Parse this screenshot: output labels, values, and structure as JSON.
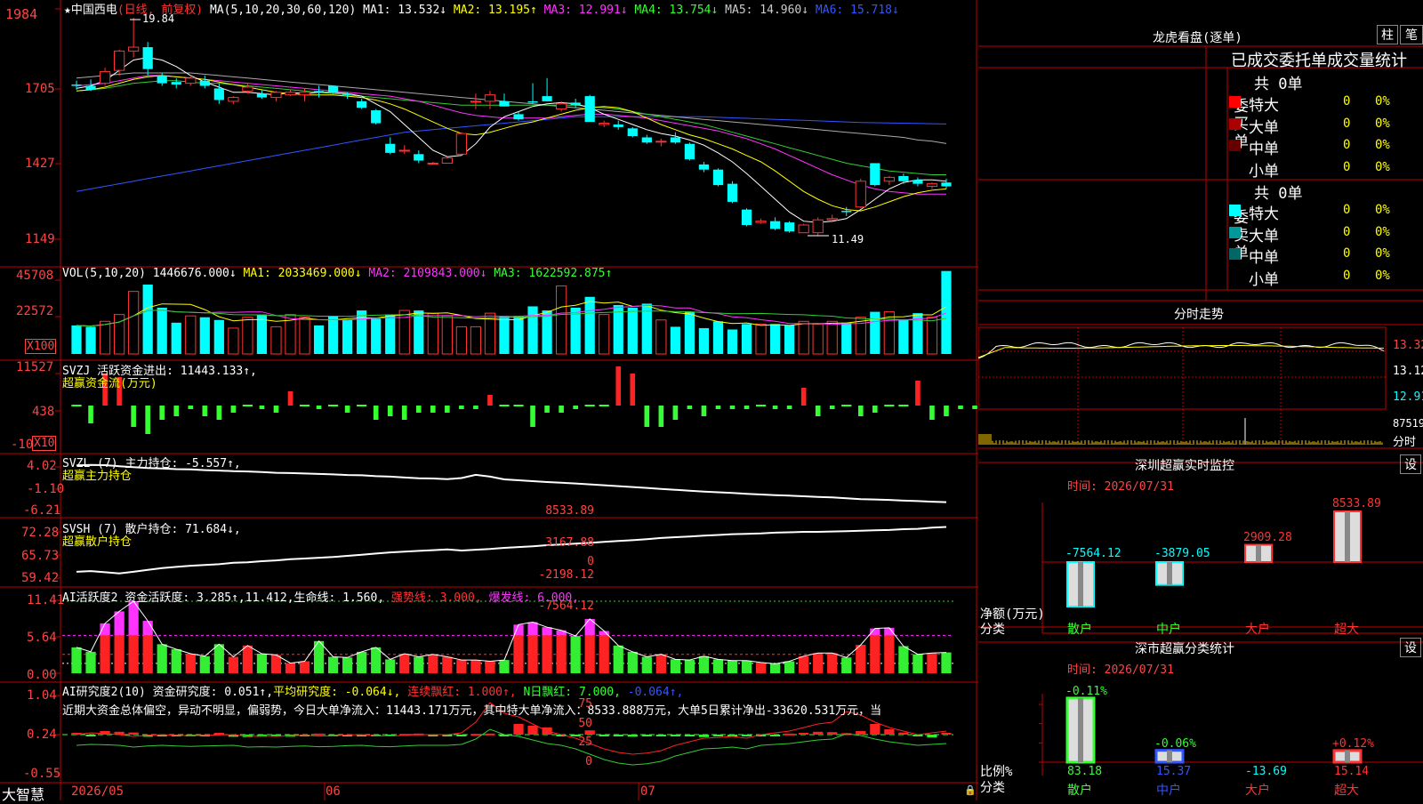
{
  "app": {
    "brand": "大智慧"
  },
  "main": {
    "title_prefix": "★中国西电",
    "period": "(日线, 前复权)",
    "ma_header": "MA(5,10,20,30,60,120)",
    "ma": [
      {
        "label": "MA1: 13.532↓",
        "color": "#ffffff"
      },
      {
        "label": "MA2: 13.195↑",
        "color": "#ffff00"
      },
      {
        "label": "MA3: 12.991↓",
        "color": "#ff33ff"
      },
      {
        "label": "MA4: 13.754↓",
        "color": "#33ff33"
      },
      {
        "label": "MA5: 14.960↓",
        "color": "#cccccc"
      },
      {
        "label": "MA6: 15.718↓",
        "color": "#3355ff"
      }
    ],
    "y_ticks": [
      "1984",
      "1705",
      "1427",
      "1149"
    ],
    "high_label": "19.84",
    "low_label": "11.49",
    "candles": [
      [
        17.25,
        17.4,
        17.05,
        17.2
      ],
      [
        17.2,
        17.45,
        17.0,
        17.05
      ],
      [
        17.3,
        17.9,
        17.2,
        17.75
      ],
      [
        17.8,
        18.6,
        17.6,
        18.55
      ],
      [
        18.55,
        19.84,
        18.3,
        18.7
      ],
      [
        18.7,
        18.9,
        17.6,
        17.85
      ],
      [
        17.6,
        17.7,
        17.2,
        17.3
      ],
      [
        17.35,
        17.5,
        17.1,
        17.25
      ],
      [
        17.3,
        17.6,
        17.2,
        17.5
      ],
      [
        17.4,
        17.6,
        17.1,
        17.2
      ],
      [
        17.1,
        17.3,
        16.5,
        16.65
      ],
      [
        16.6,
        16.8,
        16.5,
        16.75
      ],
      [
        17.0,
        17.3,
        16.9,
        17.15
      ],
      [
        16.9,
        17.05,
        16.7,
        16.75
      ],
      [
        16.75,
        17.0,
        16.6,
        16.95
      ],
      [
        16.85,
        17.05,
        16.8,
        16.95
      ],
      [
        16.85,
        17.1,
        16.6,
        16.95
      ],
      [
        17.0,
        17.2,
        16.75,
        16.95
      ],
      [
        17.2,
        17.2,
        16.9,
        16.95
      ],
      [
        16.9,
        16.95,
        16.7,
        16.85
      ],
      [
        16.6,
        16.7,
        16.3,
        16.35
      ],
      [
        16.25,
        16.3,
        15.7,
        15.75
      ],
      [
        14.95,
        15.2,
        14.55,
        14.6
      ],
      [
        14.7,
        14.9,
        14.55,
        14.7
      ],
      [
        14.55,
        14.7,
        14.2,
        14.3
      ],
      [
        14.2,
        14.25,
        14.15,
        14.2
      ],
      [
        14.2,
        14.45,
        14.2,
        14.4
      ],
      [
        14.55,
        15.4,
        14.5,
        15.35
      ],
      [
        16.6,
        16.9,
        16.3,
        16.6
      ],
      [
        16.6,
        17.0,
        16.3,
        16.85
      ],
      [
        16.6,
        16.9,
        16.4,
        16.4
      ],
      [
        16.1,
        16.2,
        15.85,
        15.9
      ],
      [
        16.6,
        17.3,
        16.5,
        16.55
      ],
      [
        16.8,
        17.5,
        16.6,
        16.6
      ],
      [
        16.3,
        16.6,
        16.2,
        16.5
      ],
      [
        16.55,
        16.7,
        16.35,
        16.45
      ],
      [
        16.8,
        16.85,
        15.8,
        15.8
      ],
      [
        15.7,
        15.85,
        15.6,
        15.75
      ],
      [
        15.7,
        15.85,
        15.5,
        15.6
      ],
      [
        15.55,
        15.6,
        15.2,
        15.25
      ],
      [
        15.2,
        15.3,
        14.95,
        15.0
      ],
      [
        15.05,
        15.15,
        14.85,
        15.05
      ],
      [
        15.2,
        15.4,
        14.95,
        15.0
      ],
      [
        14.95,
        15.0,
        14.3,
        14.35
      ],
      [
        14.15,
        14.25,
        13.85,
        13.95
      ],
      [
        13.95,
        14.0,
        13.3,
        13.35
      ],
      [
        13.4,
        13.5,
        12.65,
        12.7
      ],
      [
        12.4,
        12.45,
        11.75,
        11.8
      ],
      [
        11.9,
        12.05,
        11.85,
        11.95
      ],
      [
        11.95,
        12.1,
        11.6,
        11.65
      ],
      [
        11.9,
        11.95,
        11.5,
        11.55
      ],
      [
        11.5,
        11.85,
        11.49,
        11.8
      ],
      [
        11.5,
        12.1,
        11.4,
        12.0
      ],
      [
        12.0,
        12.2,
        11.9,
        12.05
      ],
      [
        12.35,
        12.5,
        12.15,
        12.3
      ],
      [
        12.5,
        13.6,
        12.45,
        13.5
      ],
      [
        14.2,
        14.2,
        13.3,
        13.35
      ],
      [
        13.5,
        13.7,
        13.35,
        13.65
      ],
      [
        13.7,
        13.8,
        13.4,
        13.5
      ],
      [
        13.55,
        13.65,
        13.3,
        13.4
      ],
      [
        13.3,
        13.45,
        13.2,
        13.4
      ],
      [
        13.45,
        13.6,
        13.2,
        13.3
      ]
    ],
    "ma_lines": {
      "ma1": [
        17.1,
        17.2,
        17.4,
        17.8,
        18.2,
        18.3,
        18.2,
        17.95,
        17.6,
        17.35,
        17.15,
        16.95,
        16.95,
        16.9,
        16.85,
        16.95,
        16.9,
        16.95,
        16.95,
        16.9,
        16.8,
        16.5,
        16.2,
        15.7,
        15.2,
        14.7,
        14.45,
        14.5,
        14.95,
        15.6,
        16.0,
        16.2,
        16.4,
        16.5,
        16.55,
        16.5,
        16.35,
        16.1,
        15.9,
        15.7,
        15.5,
        15.35,
        15.25,
        15.1,
        14.9,
        14.6,
        14.25,
        13.8,
        13.3,
        12.8,
        12.3,
        11.95,
        11.9,
        11.95,
        12.05,
        12.4,
        12.8,
        13.2,
        13.45,
        13.55,
        13.55,
        13.5
      ],
      "ma2": [
        17.0,
        17.05,
        17.15,
        17.3,
        17.45,
        17.55,
        17.6,
        17.55,
        17.5,
        17.45,
        17.35,
        17.25,
        17.15,
        17.05,
        16.95,
        16.9,
        16.85,
        16.85,
        16.85,
        16.8,
        16.75,
        16.65,
        16.5,
        16.3,
        16.05,
        15.8,
        15.55,
        15.35,
        15.3,
        15.4,
        15.55,
        15.7,
        15.8,
        15.95,
        16.1,
        16.25,
        16.35,
        16.4,
        16.35,
        16.2,
        15.95,
        15.7,
        15.5,
        15.3,
        15.15,
        14.95,
        14.75,
        14.5,
        14.25,
        13.9,
        13.5,
        13.1,
        12.8,
        12.55,
        12.4,
        12.35,
        12.5,
        12.7,
        12.9,
        13.05,
        13.15,
        13.2
      ],
      "ma3": [
        17.2,
        17.25,
        17.3,
        17.4,
        17.5,
        17.6,
        17.6,
        17.55,
        17.5,
        17.45,
        17.4,
        17.35,
        17.3,
        17.25,
        17.2,
        17.15,
        17.1,
        17.05,
        17.0,
        16.95,
        16.9,
        16.85,
        16.8,
        16.7,
        16.6,
        16.45,
        16.3,
        16.15,
        16.05,
        16.0,
        15.95,
        15.95,
        15.95,
        15.95,
        16.0,
        16.05,
        16.1,
        16.1,
        16.05,
        16.0,
        15.95,
        15.85,
        15.75,
        15.65,
        15.55,
        15.45,
        15.3,
        15.15,
        14.95,
        14.75,
        14.5,
        14.25,
        14.0,
        13.75,
        13.55,
        13.35,
        13.2,
        13.1,
        13.05,
        13.0,
        13.0,
        13.0
      ],
      "ma4": [
        17.0,
        17.05,
        17.1,
        17.2,
        17.3,
        17.35,
        17.4,
        17.4,
        17.35,
        17.3,
        17.3,
        17.25,
        17.2,
        17.15,
        17.1,
        17.05,
        17.0,
        16.95,
        16.9,
        16.85,
        16.8,
        16.75,
        16.7,
        16.65,
        16.6,
        16.55,
        16.5,
        16.45,
        16.45,
        16.45,
        16.45,
        16.45,
        16.45,
        16.45,
        16.45,
        16.45,
        16.4,
        16.35,
        16.3,
        16.2,
        16.1,
        16.0,
        15.9,
        15.8,
        15.7,
        15.55,
        15.4,
        15.25,
        15.1,
        14.95,
        14.8,
        14.65,
        14.5,
        14.35,
        14.2,
        14.1,
        14.0,
        13.9,
        13.85,
        13.8,
        13.75,
        13.75
      ],
      "ma5": [
        17.5,
        17.55,
        17.6,
        17.65,
        17.7,
        17.7,
        17.7,
        17.7,
        17.7,
        17.65,
        17.6,
        17.55,
        17.5,
        17.45,
        17.4,
        17.35,
        17.3,
        17.25,
        17.2,
        17.15,
        17.1,
        17.05,
        17.0,
        16.95,
        16.9,
        16.85,
        16.8,
        16.75,
        16.7,
        16.65,
        16.6,
        16.55,
        16.5,
        16.45,
        16.4,
        16.35,
        16.3,
        16.25,
        16.2,
        16.15,
        16.1,
        16.05,
        16.0,
        15.95,
        15.9,
        15.85,
        15.8,
        15.75,
        15.7,
        15.65,
        15.6,
        15.55,
        15.5,
        15.45,
        15.4,
        15.35,
        15.3,
        15.25,
        15.2,
        15.1,
        15.05,
        14.96
      ],
      "ma6": [
        13.1,
        13.2,
        13.3,
        13.4,
        13.5,
        13.6,
        13.7,
        13.8,
        13.9,
        14.0,
        14.1,
        14.2,
        14.3,
        14.4,
        14.5,
        14.6,
        14.7,
        14.8,
        14.9,
        15.0,
        15.1,
        15.2,
        15.3,
        15.4,
        15.45,
        15.5,
        15.55,
        15.6,
        15.65,
        15.7,
        15.75,
        15.8,
        15.85,
        15.9,
        15.95,
        16.0,
        16.0,
        16.0,
        16.0,
        16.0,
        16.0,
        16.0,
        16.0,
        16.0,
        16.0,
        15.98,
        15.96,
        15.94,
        15.92,
        15.9,
        15.88,
        15.86,
        15.84,
        15.82,
        15.8,
        15.78,
        15.77,
        15.76,
        15.75,
        15.74,
        15.73,
        15.72
      ]
    }
  },
  "vol": {
    "header": "VOL(5,10,20)",
    "value": "1446676.000↓",
    "ma": [
      {
        "label": "MA1: 2033469.000↓",
        "color": "#ffff00"
      },
      {
        "label": "MA2: 2109843.000↓",
        "color": "#ff33ff"
      },
      {
        "label": "MA3: 1622592.875↑",
        "color": "#33ff33"
      }
    ],
    "y_ticks": [
      "45708",
      "22572",
      "X100"
    ],
    "bars": [
      210,
      200,
      240,
      290,
      460,
      510,
      340,
      230,
      280,
      270,
      250,
      190,
      270,
      290,
      200,
      290,
      270,
      210,
      280,
      250,
      320,
      260,
      290,
      320,
      320,
      300,
      280,
      200,
      200,
      300,
      280,
      280,
      350,
      320,
      500,
      340,
      420,
      290,
      360,
      340,
      370,
      250,
      200,
      310,
      190,
      240,
      180,
      220,
      220,
      220,
      210,
      240,
      220,
      240,
      230,
      270,
      310,
      310,
      250,
      300,
      270,
      610
    ]
  },
  "svzj": {
    "header": "SVZJ",
    "label": "活跃资金进出: 11443.133↑,",
    "sub": "超赢资金流(万元)",
    "y_ticks": [
      "11527",
      "438",
      "-10"
    ],
    "x10": "X10",
    "bars": [
      0,
      -5,
      9,
      8,
      -6,
      -8,
      -4,
      -3,
      -1,
      -3,
      -4,
      -2,
      0,
      -1,
      -2,
      4,
      0,
      -1,
      0,
      -2,
      0,
      -4,
      -3,
      -4,
      -2,
      -2,
      -2,
      -1,
      -1,
      3,
      0,
      0,
      -6,
      -2,
      -2,
      -1,
      0,
      0,
      11,
      9,
      -6,
      -6,
      -4,
      -1,
      -3,
      -1,
      -1,
      -1,
      0,
      -1,
      -1,
      5,
      -3,
      -1,
      0,
      -3,
      -2,
      0,
      0,
      7,
      -4,
      -3,
      -1,
      -1,
      -2
    ]
  },
  "svzl": {
    "header": "SVZL (7)",
    "label": "主力持仓: -5.557↑,",
    "sub": "超赢主力持仓",
    "y_ticks": [
      "4.02",
      "-1.10",
      "-6.21"
    ],
    "line": [
      2.6,
      2.7,
      2.65,
      2.4,
      2.2,
      2.0,
      1.9,
      1.75,
      1.7,
      1.55,
      1.45,
      1.3,
      1.25,
      1.1,
      0.95,
      0.9,
      0.8,
      0.7,
      0.6,
      0.45,
      0.4,
      0.2,
      0.1,
      -0.1,
      -0.25,
      -0.3,
      -0.45,
      -0.2,
      0.5,
      0.1,
      -0.5,
      -0.7,
      -0.9,
      -1.1,
      -1.25,
      -1.4,
      -1.6,
      -1.8,
      -2.0,
      -2.2,
      -2.4,
      -2.6,
      -2.8,
      -3.0,
      -3.2,
      -3.35,
      -3.5,
      -3.7,
      -3.85,
      -4.0,
      -4.1,
      -4.25,
      -4.4,
      -4.5,
      -4.7,
      -4.9,
      -4.95,
      -5.05,
      -5.2,
      -5.3,
      -5.45,
      -5.55
    ]
  },
  "svsh": {
    "header": "SVSH (7)",
    "label": "散户持仓: 71.684↓,",
    "sub": "超赢散户持仓",
    "y_ticks": [
      "72.28",
      "65.73",
      "59.42"
    ],
    "line": [
      59.9,
      60.1,
      59.8,
      59.5,
      59.9,
      60.4,
      60.9,
      61.2,
      61.5,
      61.7,
      61.9,
      62.3,
      62.4,
      62.7,
      62.9,
      63.2,
      63.4,
      63.6,
      63.8,
      64.1,
      64.4,
      64.7,
      65.0,
      65.2,
      65.4,
      65.6,
      65.8,
      65.5,
      65.7,
      65.9,
      66.2,
      66.4,
      66.6,
      66.9,
      67.1,
      67.3,
      67.5,
      67.8,
      68.0,
      68.2,
      68.5,
      68.8,
      69.0,
      69.2,
      69.4,
      69.6,
      69.8,
      69.9,
      70.0,
      70.2,
      70.3,
      70.4,
      70.4,
      70.5,
      70.6,
      70.7,
      70.8,
      70.9,
      71.1,
      71.2,
      71.5,
      71.7
    ]
  },
  "ai_active": {
    "header": "AI活跃度2",
    "label": "资金活跃度: 3.285↑,11.412,",
    "life": "生命线: 1.560,",
    "strong": "强势线: 3.000,",
    "burst": "爆发线: 6.000,",
    "y_ticks": [
      "11.41",
      "5.64",
      "0.00"
    ],
    "bars": [
      4.1,
      3.4,
      7.9,
      9.8,
      11.4,
      8.3,
      4.6,
      3.8,
      3.1,
      2.7,
      4.6,
      2.6,
      4.4,
      3.1,
      2.9,
      1.6,
      1.9,
      5.1,
      2.6,
      2.5,
      3.4,
      4.1,
      2.2,
      3.1,
      2.6,
      3.0,
      2.6,
      2.1,
      2.1,
      1.9,
      2.1,
      7.7,
      8.1,
      7.3,
      6.8,
      5.9,
      8.6,
      6.7,
      4.4,
      3.4,
      2.6,
      3.0,
      2.2,
      2.1,
      2.7,
      2.2,
      2.0,
      2.0,
      1.7,
      1.5,
      1.9,
      2.7,
      3.2,
      3.2,
      2.5,
      4.5,
      7.1,
      7.2,
      4.3,
      3.0,
      3.2,
      3.3
    ]
  },
  "ai_research": {
    "header": "AI研究度2(10)",
    "label": "资金研究度: 0.051↑,",
    "avg": "平均研究度: -0.064↓,",
    "red": "连续飘红: 1.000↑,",
    "nred": "N日飘红: 7.000,",
    "last": "-0.064↑,",
    "y_ticks": [
      "1.04",
      "0.24",
      "-0.55"
    ],
    "commentary": "近期大资金总体偏空，异动不明显，偏弱势，今日大单净流入：11443.171万元，其中特大单净流入：8533.888万元，大单5日累计净出-33620.531万元，当"
  },
  "dates": [
    "2026/05",
    "06",
    "07"
  ],
  "right": {
    "dragon": {
      "title": "龙虎看盘(逐单)",
      "btn1": "柱",
      "btn2": "笔",
      "subtitle": "已成交委托单成交量统计",
      "buy": {
        "side": "委买单",
        "total": "共 0单",
        "rows": [
          {
            "label": "特大",
            "v": "0",
            "p": "0%",
            "color": "#ff0000"
          },
          {
            "label": "大单",
            "v": "0",
            "p": "0%",
            "color": "#aa0000"
          },
          {
            "label": "中单",
            "v": "0",
            "p": "0%",
            "color": "#660000"
          },
          {
            "label": "小单",
            "v": "0",
            "p": "0%",
            "color": "#000000"
          }
        ]
      },
      "sell": {
        "side": "委卖单",
        "total": "共 0单",
        "rows": [
          {
            "label": "特大",
            "v": "0",
            "p": "0%",
            "color": "#00ffff"
          },
          {
            "label": "大单",
            "v": "0",
            "p": "0%",
            "color": "#009999"
          },
          {
            "label": "中单",
            "v": "0",
            "p": "0%",
            "color": "#006666"
          },
          {
            "label": "小单",
            "v": "0",
            "p": "0%",
            "color": "#000000"
          }
        ]
      }
    },
    "intraday": {
      "title": "分时走势",
      "ticks": [
        "13.32",
        "13.12",
        "12.91"
      ],
      "vol_tick": "87519",
      "vol_label": "分时"
    },
    "monitor": {
      "title": "深圳超赢实时监控",
      "btn": "设",
      "time": "时间: 2026/07/31",
      "y_ticks": [
        "8533.89",
        "3167.88",
        "0",
        "-2198.12",
        "-7564.12"
      ],
      "axis_label": "净额(万元)",
      "cat_label": "分类",
      "bars": [
        {
          "cat": "散户",
          "value": -7564.12,
          "label": "-7564.12"
        },
        {
          "cat": "中户",
          "value": -3879.05,
          "label": "-3879.05"
        },
        {
          "cat": "大户",
          "value": 2909.28,
          "label": "2909.28"
        },
        {
          "cat": "超大",
          "value": 8533.89,
          "label": "8533.89"
        }
      ]
    },
    "classify": {
      "title": "深市超赢分类统计",
      "btn": "设",
      "time": "时间: 2026/07/31",
      "y_ticks": [
        "75",
        "50",
        "25",
        "0"
      ],
      "axis_label": "比例%",
      "cat_label": "分类",
      "bars": [
        {
          "cat": "散户",
          "value": 83.18,
          "label": "83.18",
          "change": "-0.11%",
          "change_color": "#33ff33"
        },
        {
          "cat": "中户",
          "value": 15.37,
          "label": "15.37",
          "change": "-0.06%",
          "change_color": "#33ff33"
        },
        {
          "cat": "大户",
          "value": -13.69,
          "label": "-13.69",
          "change": "",
          "change_color": "#ffffff"
        },
        {
          "cat": "超大",
          "value": 15.14,
          "label": "15.14",
          "change": "+0.12%",
          "change_color": "#ff3333"
        }
      ]
    }
  }
}
